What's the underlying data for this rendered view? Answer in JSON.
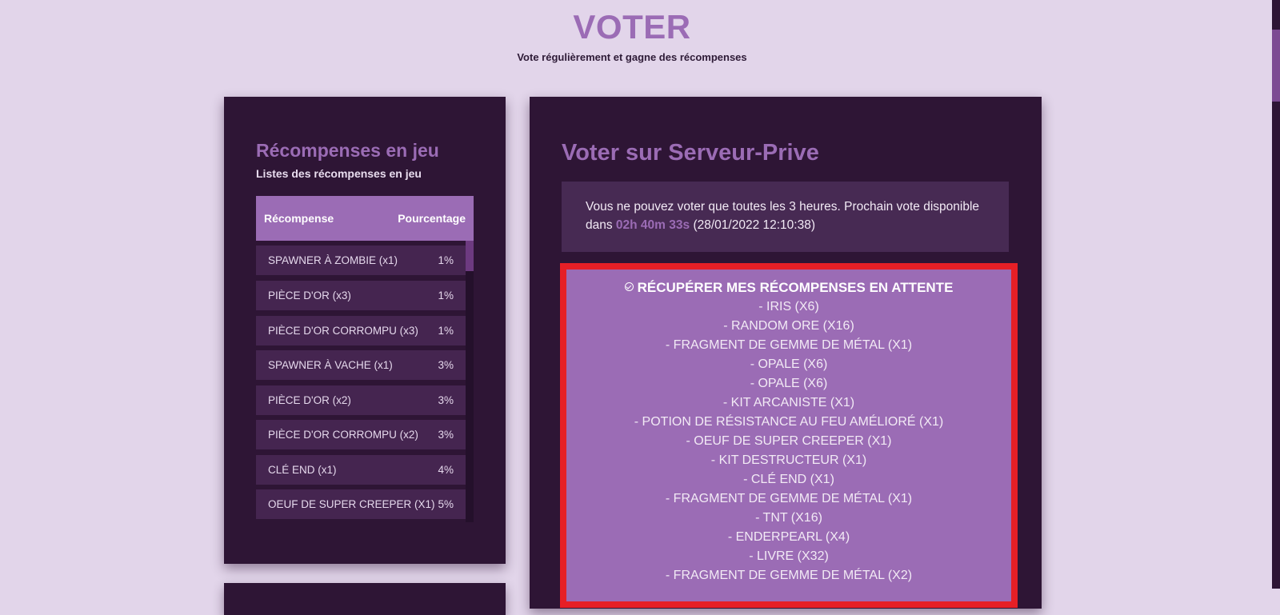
{
  "header": {
    "title": "VOTER",
    "subtitle": "Vote régulièrement et gagne des récompenses"
  },
  "rewards": {
    "title": "Récompenses en jeu",
    "subtitle": "Listes des récompenses en jeu",
    "columns": [
      "Récompense",
      "Pourcentage"
    ],
    "rows": [
      {
        "name": "SPAWNER À ZOMBIE (x1)",
        "percent": "1%"
      },
      {
        "name": "PIÈCE D'OR (x3)",
        "percent": "1%"
      },
      {
        "name": "PIÈCE D'OR CORROMPU (x3)",
        "percent": "1%"
      },
      {
        "name": "SPAWNER À VACHE (x1)",
        "percent": "3%"
      },
      {
        "name": "PIÈCE D'OR (x2)",
        "percent": "3%"
      },
      {
        "name": "PIÈCE D'OR CORROMPU (x2)",
        "percent": "3%"
      },
      {
        "name": "CLÉ END (x1)",
        "percent": "4%"
      },
      {
        "name": "OEUF DE SUPER CREEPER (X1)",
        "percent": "5%"
      }
    ]
  },
  "vote": {
    "title": "Voter sur Serveur-Prive",
    "info_before": "Vous ne pouvez voter que toutes les 3 heures. Prochain vote disponible dans ",
    "countdown": "02h 40m 33s",
    "info_after": " (28/01/2022 12:10:38)"
  },
  "pending": {
    "title": "RÉCUPÉRER MES RÉCOMPENSES EN ATTENTE",
    "items": [
      "- IRIS (X6)",
      "- RANDOM ORE (X16)",
      "- FRAGMENT DE GEMME DE MÉTAL (X1)",
      "- OPALE (X6)",
      "- OPALE (X6)",
      "- KIT ARCANISTE (X1)",
      "- POTION DE RÉSISTANCE AU FEU AMÉLIORÉ (X1)",
      "- OEUF DE SUPER CREEPER (X1)",
      "- KIT DESTRUCTEUR (X1)",
      "- CLÉ END (X1)",
      "- FRAGMENT DE GEMME DE MÉTAL (X1)",
      "- TNT (X16)",
      "- ENDERPEARL (X4)",
      "- LIVRE (X32)",
      "- FRAGMENT DE GEMME DE MÉTAL (X2)"
    ]
  },
  "icons": {
    "pending_icon": "check-circle-icon"
  },
  "colors": {
    "background": "#e2d5ea",
    "panel": "#2e1535",
    "accent": "#9b6cb5",
    "highlight_border": "#e61f26"
  }
}
